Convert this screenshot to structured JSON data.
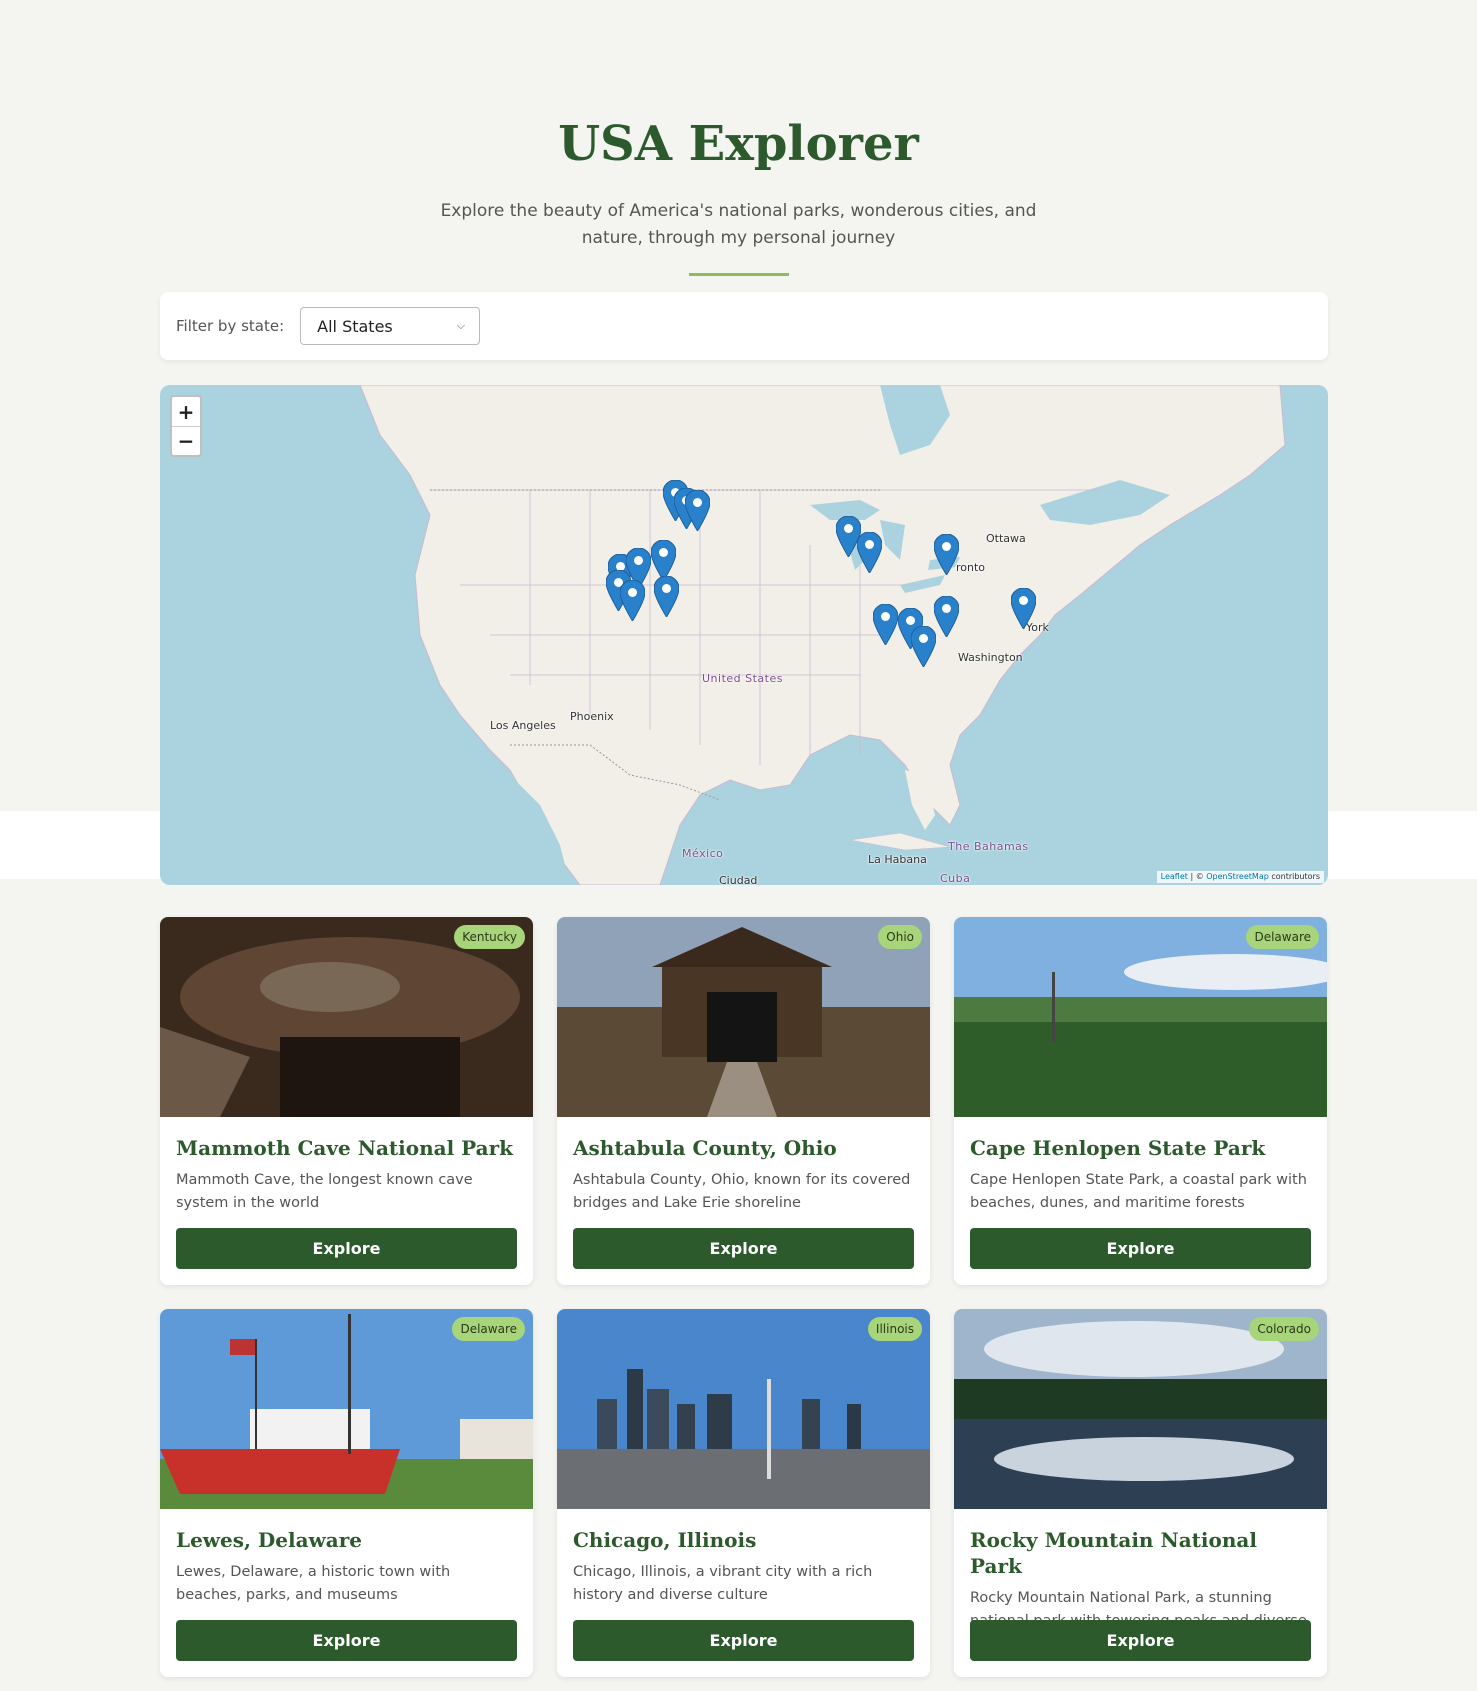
{
  "header": {
    "title": "USA Explorer",
    "subtitle": "Explore the beauty of America's national parks, wonderous cities, and nature, through my personal journey"
  },
  "filter": {
    "label": "Filter by state:",
    "selected": "All States"
  },
  "map": {
    "zoom_in": "+",
    "zoom_out": "−",
    "labels": {
      "ottawa": "Ottawa",
      "toronto": "ronto",
      "new_york": "York",
      "washington": "Washington",
      "united_states": "United States",
      "phoenix": "Phoenix",
      "los_angeles": "Los Angeles",
      "mexico": "México",
      "ciudad": "Ciudad",
      "la_habana": "La Habana",
      "bahamas": "The Bahamas",
      "cuba": "Cuba"
    },
    "attribution": {
      "leaflet": "Leaflet",
      "sep": " | © ",
      "osm": "OpenStreetMap",
      "contributors": " contributors"
    },
    "marker_icon": "map-marker-icon",
    "marker_color": "#2a81cb"
  },
  "cards": [
    {
      "state": "Kentucky",
      "title": "Mammoth Cave National Park",
      "description": "Mammoth Cave, the longest known cave system in the world",
      "button": "Explore"
    },
    {
      "state": "Ohio",
      "title": "Ashtabula County, Ohio",
      "description": "Ashtabula County, Ohio, known for its covered bridges and Lake Erie shoreline",
      "button": "Explore"
    },
    {
      "state": "Delaware",
      "title": "Cape Henlopen State Park",
      "description": "Cape Henlopen State Park, a coastal park with beaches, dunes, and maritime forests",
      "button": "Explore"
    },
    {
      "state": "Delaware",
      "title": "Lewes, Delaware",
      "description": "Lewes, Delaware, a historic town with beaches, parks, and museums",
      "button": "Explore"
    },
    {
      "state": "Illinois",
      "title": "Chicago, Illinois",
      "description": "Chicago, Illinois, a vibrant city with a rich history and diverse culture",
      "button": "Explore"
    },
    {
      "state": "Colorado",
      "title": "Rocky Mountain National Park",
      "description": "Rocky Mountain National Park, a stunning national park with towering peaks and diverse wildlife",
      "button": "Explore"
    }
  ],
  "colors": {
    "brand_green": "#2d5a2d",
    "accent_green": "#8cbd5a",
    "badge_green": "#a8d47a",
    "background": "#f4f4f0"
  }
}
